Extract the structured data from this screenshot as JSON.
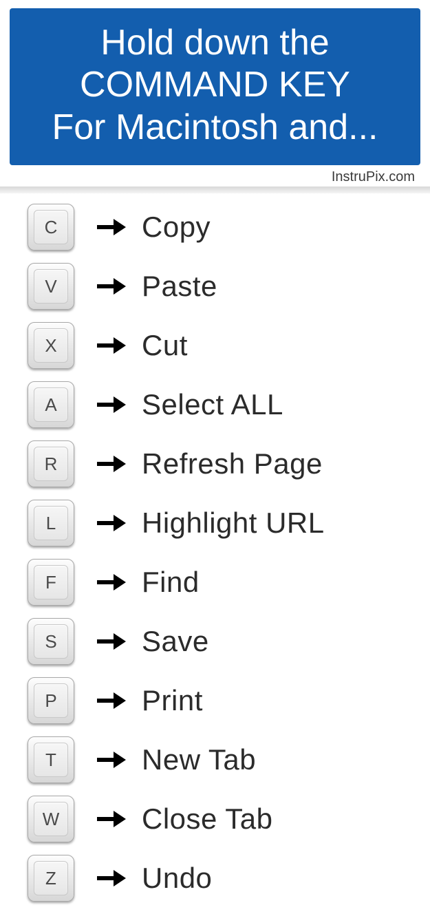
{
  "header": {
    "line1": "Hold down the",
    "line2": "COMMAND KEY",
    "line3": "For Macintosh and..."
  },
  "attribution": "InstruPix.com",
  "shortcuts": [
    {
      "key": "C",
      "action": "Copy"
    },
    {
      "key": "V",
      "action": "Paste"
    },
    {
      "key": "X",
      "action": "Cut"
    },
    {
      "key": "A",
      "action": "Select  ALL"
    },
    {
      "key": "R",
      "action": "Refresh Page"
    },
    {
      "key": "L",
      "action": "Highlight URL"
    },
    {
      "key": "F",
      "action": "Find"
    },
    {
      "key": "S",
      "action": "Save"
    },
    {
      "key": "P",
      "action": "Print"
    },
    {
      "key": "T",
      "action": "New Tab"
    },
    {
      "key": "W",
      "action": "Close Tab"
    },
    {
      "key": "Z",
      "action": "Undo"
    }
  ]
}
